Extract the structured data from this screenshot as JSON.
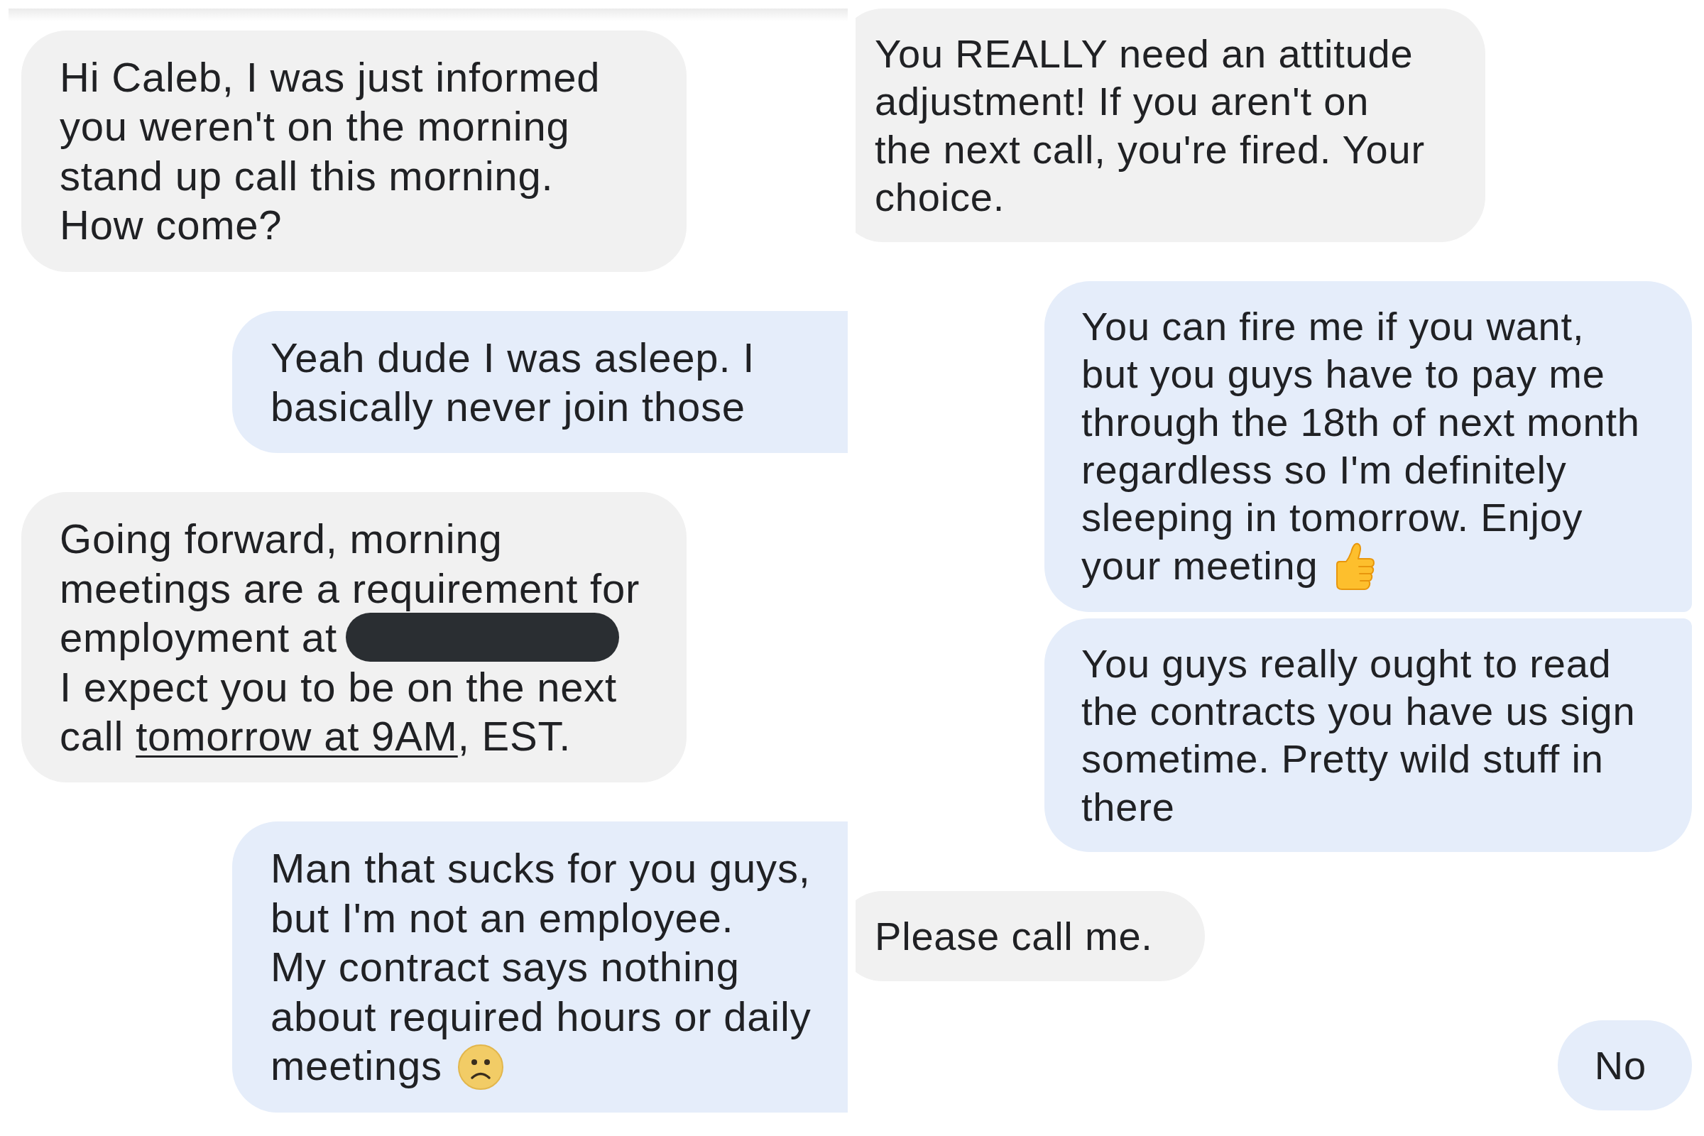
{
  "panels": [
    {
      "messages": [
        {
          "kind": "received",
          "paragraphs": [
            {
              "parts": [
                {
                  "kind": "text",
                  "text": "Hi Caleb, I was just informed you weren't on the morning stand up call this morning. How come?"
                }
              ]
            }
          ]
        },
        {
          "kind": "sent",
          "paragraphs": [
            {
              "parts": [
                {
                  "kind": "text",
                  "text": "Yeah dude I was asleep. I basically never join those"
                }
              ]
            }
          ]
        },
        {
          "kind": "received",
          "paragraphs": [
            {
              "parts": [
                {
                  "kind": "text",
                  "text": "Going forward, morning meetings are a requirement for employment at"
                },
                {
                  "kind": "redaction"
                }
              ]
            },
            {
              "parts": [
                {
                  "kind": "text",
                  "text": "I expect you to be on the next call "
                },
                {
                  "kind": "link",
                  "text": "tomorrow at 9AM"
                },
                {
                  "kind": "text",
                  "text": ", EST."
                }
              ]
            }
          ]
        },
        {
          "kind": "sent",
          "paragraphs": [
            {
              "parts": [
                {
                  "kind": "text",
                  "text": "Man that sucks for you guys, but I'm not an employee."
                }
              ]
            },
            {
              "parts": [
                {
                  "kind": "text",
                  "text": "My contract says nothing about required hours or daily meetings"
                },
                {
                  "kind": "frown"
                }
              ]
            }
          ]
        }
      ]
    },
    {
      "messages": [
        {
          "kind": "received",
          "paragraphs": [
            {
              "parts": [
                {
                  "kind": "text",
                  "text": "You REALLY need an attitude adjustment! If you aren't on the next call, you're fired. Your choice."
                }
              ]
            }
          ]
        },
        {
          "kind": "sent",
          "paragraphs": [
            {
              "parts": [
                {
                  "kind": "text",
                  "text": "You can fire me if you want, but you guys have to pay me through the 18th of next month regardless so I'm definitely sleeping in tomorrow. Enjoy your meeting"
                },
                {
                  "kind": "thumbsup"
                }
              ]
            }
          ]
        },
        {
          "kind": "sent",
          "paragraphs": [
            {
              "parts": [
                {
                  "kind": "text",
                  "text": "You guys really ought to read the contracts you have us sign sometime. Pretty wild stuff in there"
                }
              ]
            }
          ]
        },
        {
          "kind": "received",
          "paragraphs": [
            {
              "parts": [
                {
                  "kind": "text",
                  "text": "Please call me."
                }
              ]
            }
          ]
        },
        {
          "kind": "sent",
          "paragraphs": [
            {
              "parts": [
                {
                  "kind": "text",
                  "text": "No"
                }
              ]
            }
          ]
        }
      ]
    }
  ]
}
